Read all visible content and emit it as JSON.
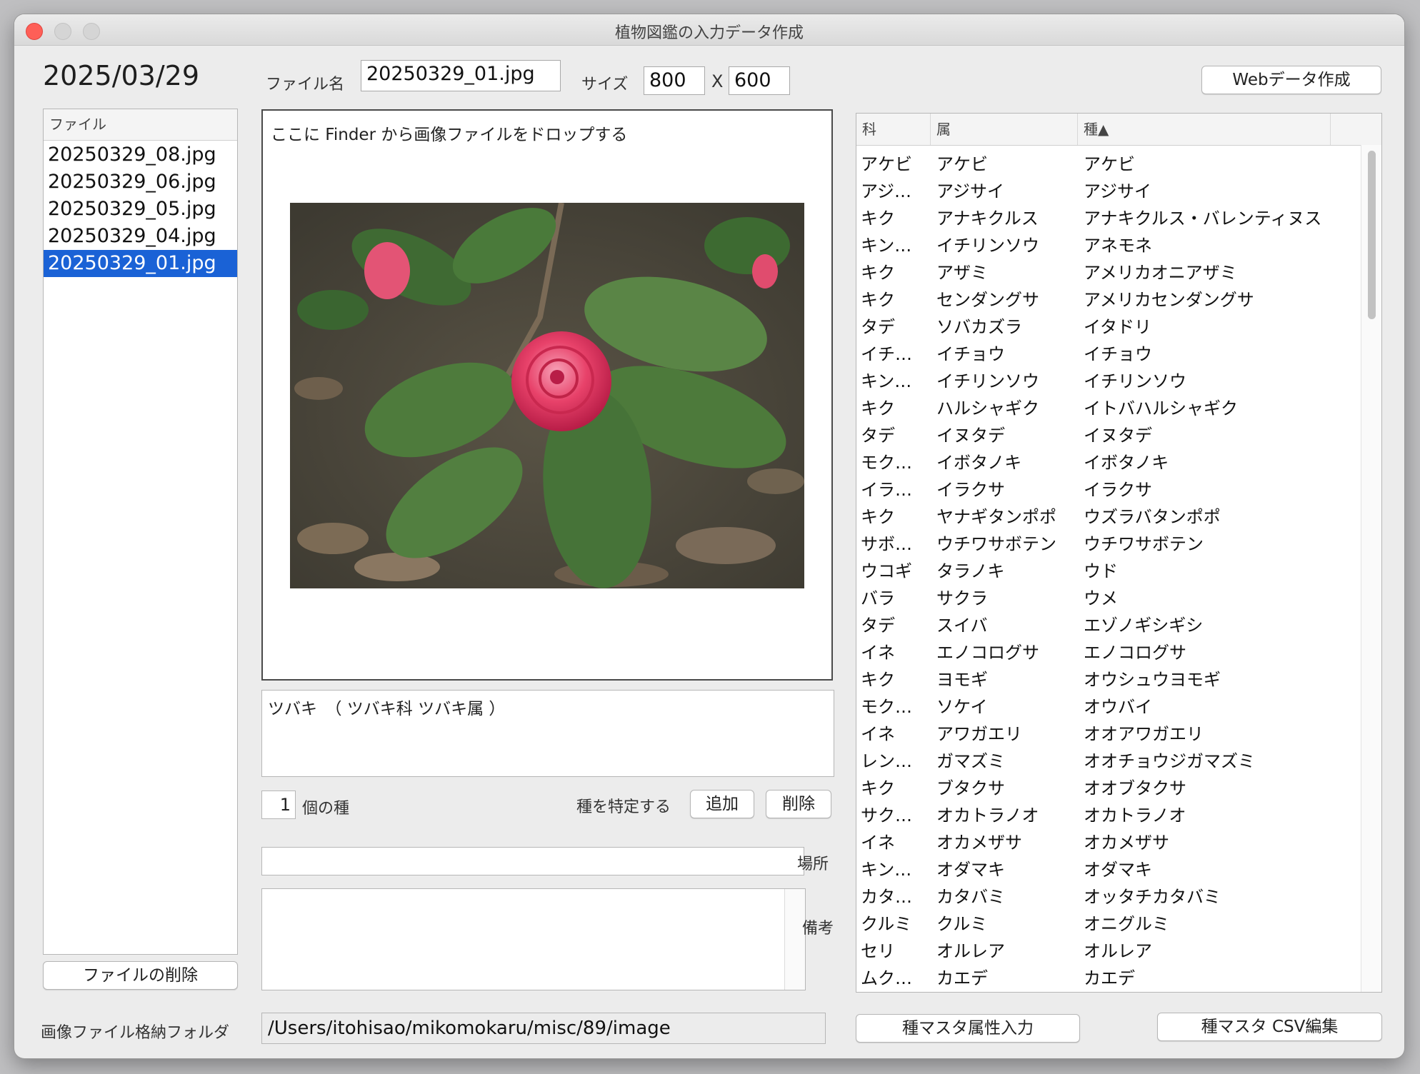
{
  "window": {
    "title": "植物図鑑の入力データ作成"
  },
  "date": "2025/03/29",
  "filename": {
    "label": "ファイル名",
    "value": "20250329_01.jpg"
  },
  "size": {
    "label": "サイズ",
    "width": "800",
    "separator": "X",
    "height": "600"
  },
  "web_button": "Webデータ作成",
  "file_list": {
    "header": "ファイル",
    "items": [
      "20250329_08.jpg",
      "20250329_06.jpg",
      "20250329_05.jpg",
      "20250329_04.jpg",
      "20250329_01.jpg"
    ],
    "selected": "20250329_01.jpg"
  },
  "delete_file_button": "ファイルの削除",
  "drop_hint": "ここに Finder から画像ファイルをドロップする",
  "image": {
    "description": "pink camellia flower with green leaves"
  },
  "description_text": "ツバキ　（ ツバキ科 ツバキ属 ）",
  "species_count": {
    "value": "1",
    "label": "個の種"
  },
  "identify_label": "種を特定する",
  "add_button": "追加",
  "remove_button": "削除",
  "place": {
    "label": "場所",
    "value": ""
  },
  "notes": {
    "label": "備考",
    "value": ""
  },
  "folder": {
    "label": "画像ファイル格納フォルダ",
    "value": "/Users/itohisao/mikomokaru/misc/89/image"
  },
  "species_table": {
    "headers": {
      "family": "科",
      "genus": "属",
      "species": "種▲"
    },
    "rows": [
      [
        "アケビ",
        "アケビ",
        "アケビ"
      ],
      [
        "アジ…",
        "アジサイ",
        "アジサイ"
      ],
      [
        "キク",
        "アナキクルス",
        "アナキクルス・バレンティヌス"
      ],
      [
        "キン…",
        "イチリンソウ",
        "アネモネ"
      ],
      [
        "キク",
        "アザミ",
        "アメリカオニアザミ"
      ],
      [
        "キク",
        "センダングサ",
        "アメリカセンダングサ"
      ],
      [
        "タデ",
        "ソバカズラ",
        "イタドリ"
      ],
      [
        "イチ…",
        "イチョウ",
        "イチョウ"
      ],
      [
        "キン…",
        "イチリンソウ",
        "イチリンソウ"
      ],
      [
        "キク",
        "ハルシャギク",
        "イトバハルシャギク"
      ],
      [
        "タデ",
        "イヌタデ",
        "イヌタデ"
      ],
      [
        "モク…",
        "イボタノキ",
        "イボタノキ"
      ],
      [
        "イラ…",
        "イラクサ",
        "イラクサ"
      ],
      [
        "キク",
        "ヤナギタンポポ",
        "ウズラバタンポポ"
      ],
      [
        "サボ…",
        "ウチワサボテン",
        "ウチワサボテン"
      ],
      [
        "ウコギ",
        "タラノキ",
        "ウド"
      ],
      [
        "バラ",
        "サクラ",
        "ウメ"
      ],
      [
        "タデ",
        "スイバ",
        "エゾノギシギシ"
      ],
      [
        "イネ",
        "エノコログサ",
        "エノコログサ"
      ],
      [
        "キク",
        "ヨモギ",
        "オウシュウヨモギ"
      ],
      [
        "モク…",
        "ソケイ",
        "オウバイ"
      ],
      [
        "イネ",
        "アワガエリ",
        "オオアワガエリ"
      ],
      [
        "レン…",
        "ガマズミ",
        "オオチョウジガマズミ"
      ],
      [
        "キク",
        "ブタクサ",
        "オオブタクサ"
      ],
      [
        "サク…",
        "オカトラノオ",
        "オカトラノオ"
      ],
      [
        "イネ",
        "オカメザサ",
        "オカメザサ"
      ],
      [
        "キン…",
        "オダマキ",
        "オダマキ"
      ],
      [
        "カタ…",
        "カタバミ",
        "オッタチカタバミ"
      ],
      [
        "クルミ",
        "クルミ",
        "オニグルミ"
      ],
      [
        "セリ",
        "オルレア",
        "オルレア"
      ],
      [
        "ムク…",
        "カエデ",
        "カエデ"
      ]
    ]
  },
  "species_master_attr_button": "種マスタ属性入力",
  "species_master_csv_button": "種マスタ CSV編集",
  "colors": {
    "selection": "#1a62d6",
    "close": "#fe5f57",
    "flower": "#e8426a"
  },
  "icons": [
    "close-button",
    "minimize-button",
    "zoom-button",
    "sort-ascending-icon"
  ]
}
